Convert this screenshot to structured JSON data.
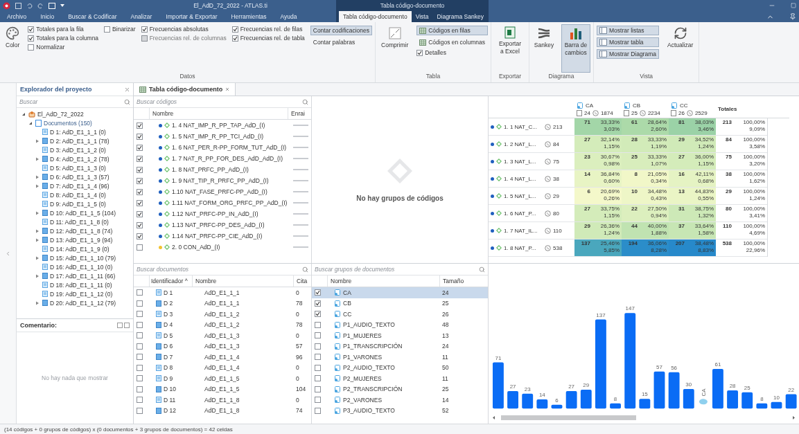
{
  "window": {
    "title": "El_AdD_72_2022 - ATLAS.ti",
    "context_title": "Tabla código-documento"
  },
  "menu_tabs": [
    {
      "label": "Archivo",
      "kind": "main",
      "selected": false
    },
    {
      "label": "Inicio",
      "kind": "main",
      "selected": false
    },
    {
      "label": "Buscar & Codificar",
      "kind": "main",
      "selected": false
    },
    {
      "label": "Analizar",
      "kind": "main",
      "selected": false
    },
    {
      "label": "Importar & Exportar",
      "kind": "main",
      "selected": false
    },
    {
      "label": "Herramientas",
      "kind": "main",
      "selected": false
    },
    {
      "label": "Ayuda",
      "kind": "main",
      "selected": false
    },
    {
      "label": "Tabla código-documento",
      "kind": "context",
      "selected": true
    },
    {
      "label": "Vista",
      "kind": "context",
      "selected": false
    },
    {
      "label": "Diagrama Sankey",
      "kind": "context",
      "selected": false
    }
  ],
  "ribbon": {
    "color_button": "Color",
    "data_columns": [
      [
        {
          "label": "Totales para la fila",
          "checked": true,
          "disabled": false
        },
        {
          "label": "Totales para la columna",
          "checked": true,
          "disabled": false
        },
        {
          "label": "Normalizar",
          "checked": false,
          "disabled": false
        }
      ],
      [
        {
          "label": "Binarizar",
          "checked": false,
          "disabled": false
        }
      ],
      [
        {
          "label": "Frecuencias absolutas",
          "checked": true,
          "disabled": false
        },
        {
          "label": "Frecuencias rel. de columnas",
          "checked": false,
          "disabled": true
        }
      ],
      [
        {
          "label": "Frecuencias rel. de filas",
          "checked": true,
          "disabled": false
        },
        {
          "label": "Frecuencias rel. de tabla",
          "checked": true,
          "disabled": false
        }
      ]
    ],
    "count_options": [
      {
        "label": "Contar codificaciones",
        "selected": true
      },
      {
        "label": "Contar palabras",
        "selected": false
      }
    ],
    "data_group": "Datos",
    "compress_button": "Comprimir",
    "layout_options": [
      {
        "label": "Códigos en filas",
        "selected": true
      },
      {
        "label": "Códigos en columnas",
        "selected": false
      }
    ],
    "details": {
      "label": "Detalles",
      "checked": true
    },
    "table_group": "Tabla",
    "export_button": "Exportar a Excel",
    "export_group": "Exportar",
    "diagram_buttons": [
      {
        "label": "Sankey",
        "selected": false
      },
      {
        "label": "Barra de cambios",
        "selected": true
      }
    ],
    "diagram_group": "Diagrama",
    "view_options": [
      {
        "label": "Mostrar listas",
        "selected": true
      },
      {
        "label": "Mostrar tabla",
        "selected": true
      },
      {
        "label": "Mostrar Diagrama",
        "selected": true
      }
    ],
    "refresh_button": "Actualizar",
    "view_group": "Vista"
  },
  "explorer": {
    "title": "Explorador del proyecto",
    "search": {
      "placeholder": "Buscar"
    },
    "tree": [
      {
        "label": "El_AdD_72_2022",
        "expanded": true,
        "children": [
          {
            "label": "Documentos (150)",
            "expanded": true,
            "children": [
              {
                "label": "D 1: AdD_E1_1_1 (0)",
                "kind": "empty"
              },
              {
                "label": "D 2: AdD_E1_1_1 (78)",
                "kind": "coded"
              },
              {
                "label": "D 3: AdD_E1_1_2 (0)",
                "kind": "empty"
              },
              {
                "label": "D 4: AdD_E1_1_2 (78)",
                "kind": "coded"
              },
              {
                "label": "D 5: AdD_E1_1_3 (0)",
                "kind": "empty"
              },
              {
                "label": "D 6: AdD_E1_1_3 (57)",
                "kind": "coded"
              },
              {
                "label": "D 7: AdD_E1_1_4 (96)",
                "kind": "coded"
              },
              {
                "label": "D 8: AdD_E1_1_4 (0)",
                "kind": "empty"
              },
              {
                "label": "D 9: AdD_E1_1_5 (0)",
                "kind": "empty"
              },
              {
                "label": "D 10: AdD_E1_1_5 (104)",
                "kind": "coded"
              },
              {
                "label": "D 11: AdD_E1_1_8 (0)",
                "kind": "empty"
              },
              {
                "label": "D 12: AdD_E1_1_8 (74)",
                "kind": "coded"
              },
              {
                "label": "D 13: AdD_E1_1_9 (94)",
                "kind": "coded"
              },
              {
                "label": "D 14: AdD_E1_1_9 (0)",
                "kind": "empty"
              },
              {
                "label": "D 15: AdD_E1_1_10 (79)",
                "kind": "coded"
              },
              {
                "label": "D 16: AdD_E1_1_10 (0)",
                "kind": "empty"
              },
              {
                "label": "D 17: AdD_E1_1_11 (66)",
                "kind": "coded"
              },
              {
                "label": "D 18: AdD_E1_1_11 (0)",
                "kind": "empty"
              },
              {
                "label": "D 19: AdD_E1_1_12 (0)",
                "kind": "empty"
              },
              {
                "label": "D 20: AdD_E1_1_12 (79)",
                "kind": "coded"
              }
            ]
          }
        ]
      }
    ],
    "comment": {
      "title": "Comentario:",
      "empty_text": "No hay nada que mostrar"
    }
  },
  "document_tab": "Tabla código-documento",
  "codes": {
    "search": {
      "placeholder": "Buscar códigos"
    },
    "columns": [
      "Nombre",
      "Enrai"
    ],
    "rows": [
      {
        "label": "1. 4 NAT_IMP_R_PP_TAP_AdD_(I)",
        "checked": true,
        "color": "#1f5fbf"
      },
      {
        "label": "1. 5 NAT_IMP_R_PP_TCI_AdD_(I)",
        "checked": true,
        "color": "#1f5fbf"
      },
      {
        "label": "1. 6 NAT_PER_R-PP_FORM_TUT_AdD_(I)",
        "checked": true,
        "color": "#1f5fbf"
      },
      {
        "label": "1. 7 NAT_R_PP_FOR_DES_AdD_AdD_(I)",
        "checked": true,
        "color": "#1f5fbf"
      },
      {
        "label": "1. 8 NAT_PRFC_PP_AdD_(I)",
        "checked": true,
        "color": "#1f5fbf"
      },
      {
        "label": "1. 9 NAT_TIP_R_PRFC_PP_AdD_(I)",
        "checked": true,
        "color": "#1f5fbf"
      },
      {
        "label": "1.10 NAT_FASE_PRFC-PP_AdD_(I)",
        "checked": true,
        "color": "#1f5fbf"
      },
      {
        "label": "1.11 NAT_FORM_ORG_PRFC_PP_AdD_(I)",
        "checked": true,
        "color": "#1f5fbf"
      },
      {
        "label": "1.12 NAT_PRFC-PP_IN_AdD_(I)",
        "checked": true,
        "color": "#1f5fbf"
      },
      {
        "label": "1.13 NAT_PRFC-PP_DES_AdD_(I)",
        "checked": true,
        "color": "#1f5fbf"
      },
      {
        "label": "1.14 NAT_PRFC-PP_CIE_AdD_(I)",
        "checked": true,
        "color": "#1f5fbf"
      },
      {
        "label": "2. 0 CON_AdD_(I)",
        "checked": false,
        "color": "#f2c230"
      }
    ]
  },
  "code_groups": {
    "empty_text": "No hay grupos de códigos"
  },
  "table": {
    "columns": [
      {
        "name": "CA",
        "docs": "24",
        "quotes": "1874"
      },
      {
        "name": "CB",
        "docs": "25",
        "quotes": "2234"
      },
      {
        "name": "CC",
        "docs": "26",
        "quotes": "2529"
      }
    ],
    "totals_label": "Totales",
    "rows": [
      {
        "code": "1. 1 NAT_C...",
        "count": "213",
        "color": "#1f5fbf",
        "cells": [
          {
            "n": "71",
            "row_pct": "33,33%",
            "table_pct": "3,03%",
            "color": "#a3d6a8"
          },
          {
            "n": "61",
            "row_pct": "28,64%",
            "table_pct": "2,60%",
            "color": "#acdaa9"
          },
          {
            "n": "81",
            "row_pct": "38,03%",
            "table_pct": "3,46%",
            "color": "#9bd2a7"
          }
        ],
        "total": "213",
        "total_pct": "100,00%",
        "total_table_pct": "9,09%"
      },
      {
        "code": "1. 2 NAT_L...",
        "count": "84",
        "color": "#1f5fbf",
        "cells": [
          {
            "n": "27",
            "row_pct": "32,14%",
            "table_pct": "1,15%",
            "color": "#d4ecba"
          },
          {
            "n": "28",
            "row_pct": "33,33%",
            "table_pct": "1,19%",
            "color": "#d2ebb9"
          },
          {
            "n": "29",
            "row_pct": "34,52%",
            "table_pct": "1,24%",
            "color": "#d0eab8"
          }
        ],
        "total": "84",
        "total_pct": "100,00%",
        "total_table_pct": "3,58%"
      },
      {
        "code": "1. 3 NAT_L...",
        "count": "75",
        "color": "#1f5fbf",
        "cells": [
          {
            "n": "23",
            "row_pct": "30,67%",
            "table_pct": "0,98%",
            "color": "#dbefbe"
          },
          {
            "n": "25",
            "row_pct": "33,33%",
            "table_pct": "1,07%",
            "color": "#d8edbc"
          },
          {
            "n": "27",
            "row_pct": "36,00%",
            "table_pct": "1,15%",
            "color": "#d4ecba"
          }
        ],
        "total": "75",
        "total_pct": "100,00%",
        "total_table_pct": "3,20%"
      },
      {
        "code": "1. 4 NAT_L...",
        "count": "38",
        "color": "#1f5fbf",
        "cells": [
          {
            "n": "14",
            "row_pct": "36,84%",
            "table_pct": "0,60%",
            "color": "#e8f4c4"
          },
          {
            "n": "8",
            "row_pct": "21,05%",
            "table_pct": "0,34%",
            "color": "#f1f7c8"
          },
          {
            "n": "16",
            "row_pct": "42,11%",
            "table_pct": "0,68%",
            "color": "#e5f3c3"
          }
        ],
        "total": "38",
        "total_pct": "100,00%",
        "total_table_pct": "1,62%"
      },
      {
        "code": "1. 5 NAT_L...",
        "count": "29",
        "color": "#1f5fbf",
        "cells": [
          {
            "n": "6",
            "row_pct": "20,69%",
            "table_pct": "0,26%",
            "color": "#f4f8ca"
          },
          {
            "n": "10",
            "row_pct": "34,48%",
            "table_pct": "0,43%",
            "color": "#eef6c7"
          },
          {
            "n": "13",
            "row_pct": "44,83%",
            "table_pct": "0,55%",
            "color": "#eaf5c5"
          }
        ],
        "total": "29",
        "total_pct": "100,00%",
        "total_table_pct": "1,24%"
      },
      {
        "code": "1. 6 NAT_P...",
        "count": "80",
        "color": "#1f5fbf",
        "cells": [
          {
            "n": "27",
            "row_pct": "33,75%",
            "table_pct": "1,15%",
            "color": "#d4ecba"
          },
          {
            "n": "22",
            "row_pct": "27,50%",
            "table_pct": "0,94%",
            "color": "#dcefbe"
          },
          {
            "n": "31",
            "row_pct": "38,75%",
            "table_pct": "1,32%",
            "color": "#cde9b7"
          }
        ],
        "total": "80",
        "total_pct": "100,00%",
        "total_table_pct": "3,41%"
      },
      {
        "code": "1. 7 NAT_IL...",
        "count": "110",
        "color": "#1f5fbf",
        "cells": [
          {
            "n": "29",
            "row_pct": "26,36%",
            "table_pct": "1,24%",
            "color": "#d0eab8"
          },
          {
            "n": "44",
            "row_pct": "40,00%",
            "table_pct": "1,88%",
            "color": "#c0e3b1"
          },
          {
            "n": "37",
            "row_pct": "33,64%",
            "table_pct": "1,58%",
            "color": "#c7e6b4"
          }
        ],
        "total": "110",
        "total_pct": "100,00%",
        "total_table_pct": "4,69%"
      },
      {
        "code": "1. 8 NAT_P...",
        "count": "538",
        "color": "#1f5fbf",
        "cells": [
          {
            "n": "137",
            "row_pct": "25,46%",
            "table_pct": "5,85%",
            "color": "#4aa7bd"
          },
          {
            "n": "194",
            "row_pct": "36,06%",
            "table_pct": "8,28%",
            "color": "#2b8dc9"
          },
          {
            "n": "207",
            "row_pct": "38,48%",
            "table_pct": "8,83%",
            "color": "#2789ca"
          }
        ],
        "total": "538",
        "total_pct": "100,00%",
        "total_table_pct": "22,96%"
      }
    ]
  },
  "documents": {
    "search": {
      "placeholder": "Buscar documentos"
    },
    "columns": [
      "Identificador ^",
      "Nombre",
      "Cita"
    ],
    "rows": [
      {
        "id": "D 1",
        "name": "AdD_E1_1_1",
        "count": "0",
        "kind": "empty",
        "checked": false
      },
      {
        "id": "D 2",
        "name": "AdD_E1_1_1",
        "count": "78",
        "kind": "coded",
        "checked": false
      },
      {
        "id": "D 3",
        "name": "AdD_E1_1_2",
        "count": "0",
        "kind": "empty",
        "checked": false
      },
      {
        "id": "D 4",
        "name": "AdD_E1_1_2",
        "count": "78",
        "kind": "coded",
        "checked": false
      },
      {
        "id": "D 5",
        "name": "AdD_E1_1_3",
        "count": "0",
        "kind": "empty",
        "checked": false
      },
      {
        "id": "D 6",
        "name": "AdD_E1_1_3",
        "count": "57",
        "kind": "coded",
        "checked": false
      },
      {
        "id": "D 7",
        "name": "AdD_E1_1_4",
        "count": "96",
        "kind": "coded",
        "checked": false
      },
      {
        "id": "D 8",
        "name": "AdD_E1_1_4",
        "count": "0",
        "kind": "empty",
        "checked": false
      },
      {
        "id": "D 9",
        "name": "AdD_E1_1_5",
        "count": "0",
        "kind": "empty",
        "checked": false
      },
      {
        "id": "D 10",
        "name": "AdD_E1_1_5",
        "count": "104",
        "kind": "coded",
        "checked": false
      },
      {
        "id": "D 11",
        "name": "AdD_E1_1_8",
        "count": "0",
        "kind": "empty",
        "checked": false
      },
      {
        "id": "D 12",
        "name": "AdD_E1_1_8",
        "count": "74",
        "kind": "coded",
        "checked": false
      }
    ]
  },
  "document_groups": {
    "search": {
      "placeholder": "Buscar grupos de documentos"
    },
    "columns": [
      "Nombre",
      "Tamaño"
    ],
    "rows": [
      {
        "name": "CA",
        "size": "24",
        "checked": true,
        "selected": true
      },
      {
        "name": "CB",
        "size": "25",
        "checked": true,
        "selected": false
      },
      {
        "name": "CC",
        "size": "26",
        "checked": true,
        "selected": false
      },
      {
        "name": "P1_AUDIO_TEXTO",
        "size": "48",
        "checked": false,
        "selected": false
      },
      {
        "name": "P1_MUJERES",
        "size": "13",
        "checked": false,
        "selected": false
      },
      {
        "name": "P1_TRANSCRIPCIÓN",
        "size": "24",
        "checked": false,
        "selected": false
      },
      {
        "name": "P1_VARONES",
        "size": "11",
        "checked": false,
        "selected": false
      },
      {
        "name": "P2_AUDIO_TEXTO",
        "size": "50",
        "checked": false,
        "selected": false
      },
      {
        "name": "P2_MUJERES",
        "size": "11",
        "checked": false,
        "selected": false
      },
      {
        "name": "P2_TRANSCRIPCIÓN",
        "size": "25",
        "checked": false,
        "selected": false
      },
      {
        "name": "P2_VARONES",
        "size": "14",
        "checked": false,
        "selected": false
      },
      {
        "name": "P3_AUDIO_TEXTO",
        "size": "52",
        "checked": false,
        "selected": false
      }
    ]
  },
  "chart": {
    "segments": [
      {
        "chart_data": {
          "type": "bar",
          "data_labels": true,
          "categories": [
            null,
            null,
            null,
            null,
            null,
            null,
            null,
            null,
            null,
            null,
            null,
            null,
            null,
            null
          ],
          "series": [
            {
              "color": "#0a6cf5",
              "values": [
                71,
                27,
                23,
                14,
                6,
                27,
                29,
                137,
                8,
                147,
                15,
                57,
                56,
                30
              ]
            }
          ]
        }
      },
      {
        "chart_data": {
          "type": "bar",
          "data_labels": true,
          "categories": [
            null,
            null,
            null,
            null,
            null,
            null
          ],
          "series": [
            {
              "color": "#0a6cf5",
              "values": [
                61,
                28,
                25,
                8,
                10,
                22
              ]
            }
          ]
        }
      }
    ],
    "group_marker": "CA"
  },
  "status_bar": "(14 códigos + 0 grupos de códigos) x (0 documentos + 3 grupos de documentos) = 42 celdas"
}
